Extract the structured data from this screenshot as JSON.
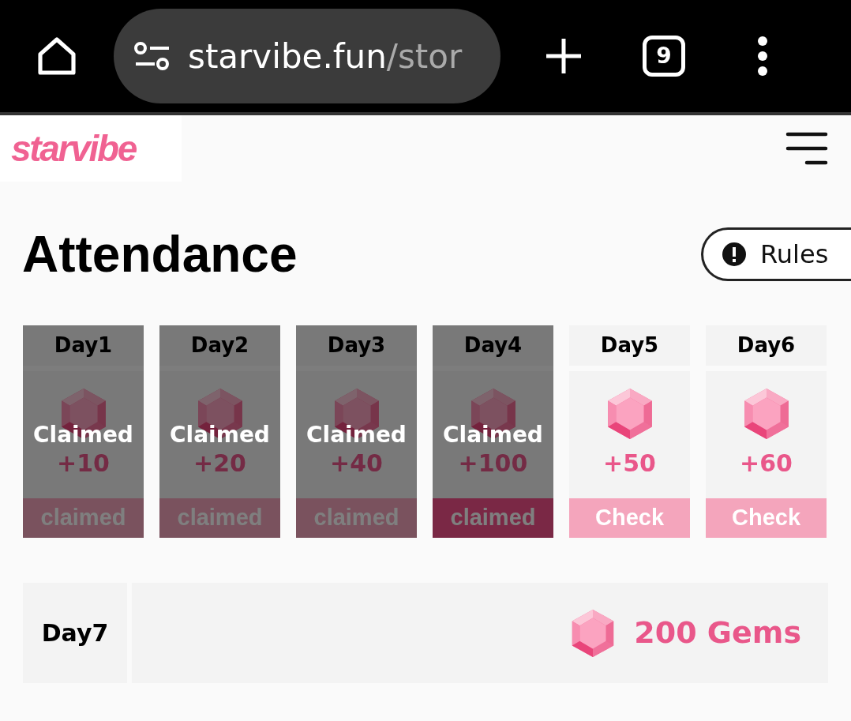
{
  "browser": {
    "url_host": "starvibe.fun",
    "url_path": "/stor",
    "tab_count": "9"
  },
  "header": {
    "logo": "starvibe"
  },
  "title": "Attendance",
  "rules_button": "Rules",
  "days": [
    {
      "label": "Day1",
      "amount": "+10",
      "claimed": true,
      "overlay_text": "Claimed",
      "button": "claimed",
      "today": false
    },
    {
      "label": "Day2",
      "amount": "+20",
      "claimed": true,
      "overlay_text": "Claimed",
      "button": "claimed",
      "today": false
    },
    {
      "label": "Day3",
      "amount": "+40",
      "claimed": true,
      "overlay_text": "Claimed",
      "button": "claimed",
      "today": false
    },
    {
      "label": "Day4",
      "amount": "+100",
      "claimed": true,
      "overlay_text": "Claimed",
      "button": "claimed",
      "today": true
    },
    {
      "label": "Day5",
      "amount": "+50",
      "claimed": false,
      "button": "Check",
      "today": false
    },
    {
      "label": "Day6",
      "amount": "+60",
      "claimed": false,
      "button": "Check",
      "today": false
    }
  ],
  "bonus": {
    "label": "Day7",
    "reward": "200 Gems"
  }
}
